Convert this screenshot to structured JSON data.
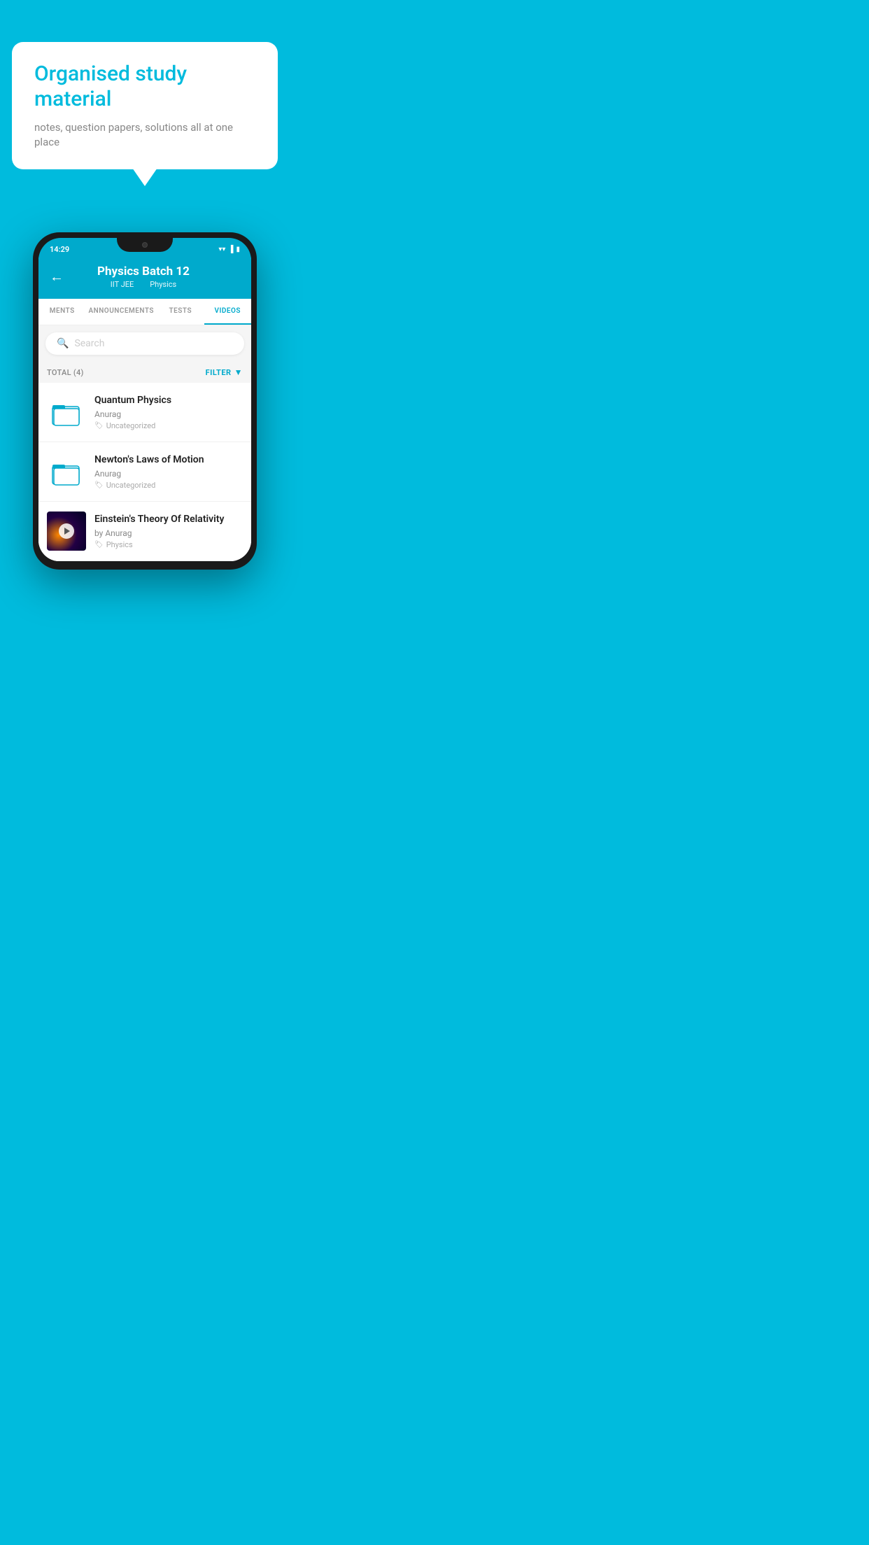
{
  "background": {
    "color": "#00BBDD"
  },
  "speech_bubble": {
    "title": "Organised study material",
    "subtitle": "notes, question papers, solutions all at one place"
  },
  "status_bar": {
    "time": "14:29",
    "wifi_icon": "▼",
    "signal_icon": "◀",
    "battery_icon": "▮"
  },
  "header": {
    "title": "Physics Batch 12",
    "subtitle_left": "IIT JEE",
    "subtitle_right": "Physics",
    "back_label": "←"
  },
  "tabs": [
    {
      "label": "MENTS",
      "active": false
    },
    {
      "label": "ANNOUNCEMENTS",
      "active": false
    },
    {
      "label": "TESTS",
      "active": false
    },
    {
      "label": "VIDEOS",
      "active": true
    }
  ],
  "search": {
    "placeholder": "Search"
  },
  "filter": {
    "total_label": "TOTAL (4)",
    "button_label": "FILTER"
  },
  "videos": [
    {
      "title": "Quantum Physics",
      "author": "Anurag",
      "tag": "Uncategorized",
      "type": "folder"
    },
    {
      "title": "Newton's Laws of Motion",
      "author": "Anurag",
      "tag": "Uncategorized",
      "type": "folder"
    },
    {
      "title": "Einstein's Theory Of Relativity",
      "author": "by Anurag",
      "tag": "Physics",
      "type": "video"
    }
  ]
}
